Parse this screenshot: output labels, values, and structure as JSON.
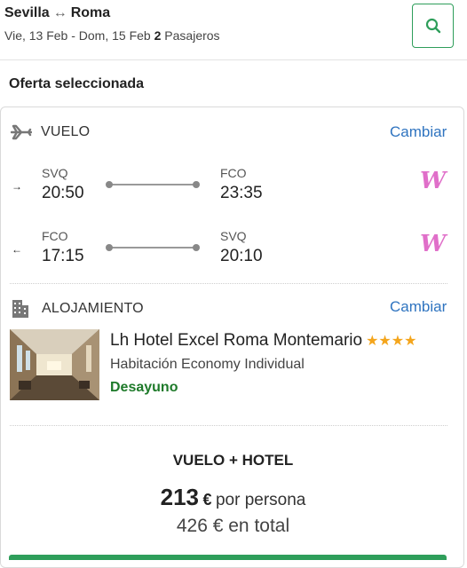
{
  "header": {
    "origin": "Sevilla",
    "destination": "Roma",
    "dates": "Vie, 13 Feb - Dom, 15 Feb",
    "passengers_count": "2",
    "passengers_label": "Pasajeros"
  },
  "selected_offer_title": "Oferta seleccionada",
  "flight": {
    "section_label": "VUELO",
    "change_label": "Cambiar",
    "legs": [
      {
        "direction": "→",
        "from_code": "SVQ",
        "from_time": "20:50",
        "to_code": "FCO",
        "to_time": "23:35",
        "airline_logo": "W"
      },
      {
        "direction": "←",
        "from_code": "FCO",
        "from_time": "17:15",
        "to_code": "SVQ",
        "to_time": "20:10",
        "airline_logo": "W"
      }
    ]
  },
  "accommodation": {
    "section_label": "ALOJAMIENTO",
    "change_label": "Cambiar",
    "hotel_name": "Lh Hotel Excel Roma Montemario",
    "stars": 4,
    "room_type": "Habitación Economy Individual",
    "meal_plan": "Desayuno"
  },
  "package": {
    "title": "VUELO + HOTEL",
    "price_per_person": "213",
    "currency": "€",
    "per_person_label": "por persona",
    "total_price": "426 € en total"
  },
  "colors": {
    "accent_green": "#2e9e5a",
    "link_blue": "#2f74c0",
    "star_orange": "#f4a51c",
    "airline_pink": "#e06fc9",
    "meal_green": "#1e7a2a"
  }
}
